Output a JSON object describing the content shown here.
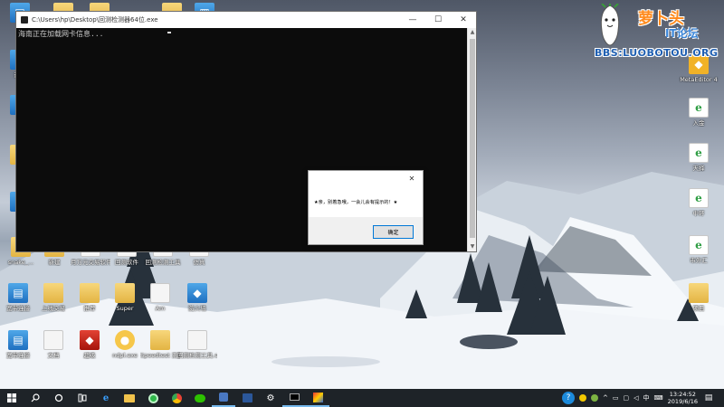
{
  "console": {
    "title": "C:\\Users\\hp\\Desktop\\回测检测器64位.exe",
    "output_line": "海南正在加载网卡信息..."
  },
  "dialog": {
    "message": "★亲，别着急哦，一会儿会有提示的！★",
    "ok_label": "确定",
    "close_label": "✕"
  },
  "watermark": {
    "title": "萝卜头",
    "subtitle": "IT论坛",
    "url": "BBS:LUOBOTOU.ORG"
  },
  "desktop_icons": {
    "left_column": [
      "远程",
      "文",
      "Te",
      "工",
      "snake_..."
    ],
    "right_column": [
      {
        "label": "MetaEditor 4",
        "icon": "meta-editor-icon"
      },
      {
        "label": "入金",
        "icon": "ie-icon"
      },
      {
        "label": "天择",
        "icon": "ie-icon"
      },
      {
        "label": "中环",
        "icon": "ie-icon"
      },
      {
        "label": "市外汇",
        "icon": "ie-icon"
      },
      {
        "label": "项目",
        "icon": "folder-icon"
      }
    ],
    "row1": [
      "snake_...",
      "新建",
      "月万元交易软件",
      "回测软件",
      "回测检测工具",
      "仿真"
    ],
    "row2": [
      "宽带连接",
      "上线交易",
      "推荐",
      "Super",
      "Am",
      "防火墙"
    ],
    "row3": [
      "宽带连接",
      "文档",
      "超级",
      "ndpl.exe",
      "Speedtest 测速工具",
      "回测检测工具.exe"
    ]
  },
  "taskbar": {
    "time": "13:24:52",
    "date": "2019/6/16",
    "ime": "中",
    "apps": [
      "start-icon",
      "search-icon",
      "cortana-icon",
      "task-view-icon",
      "edge-icon",
      "folder-icon",
      "360-browser-icon",
      "chrome-icon",
      "wechat-icon",
      "app-icon",
      "word-icon",
      "settings-icon",
      "terminal-icon",
      "colorful-app-icon"
    ]
  },
  "colors": {
    "taskbar_bg": "#1e2328",
    "console_bg": "#0c0c0c",
    "watermark_orange": "#ff8a1c",
    "watermark_blue": "#1f5fb2"
  }
}
